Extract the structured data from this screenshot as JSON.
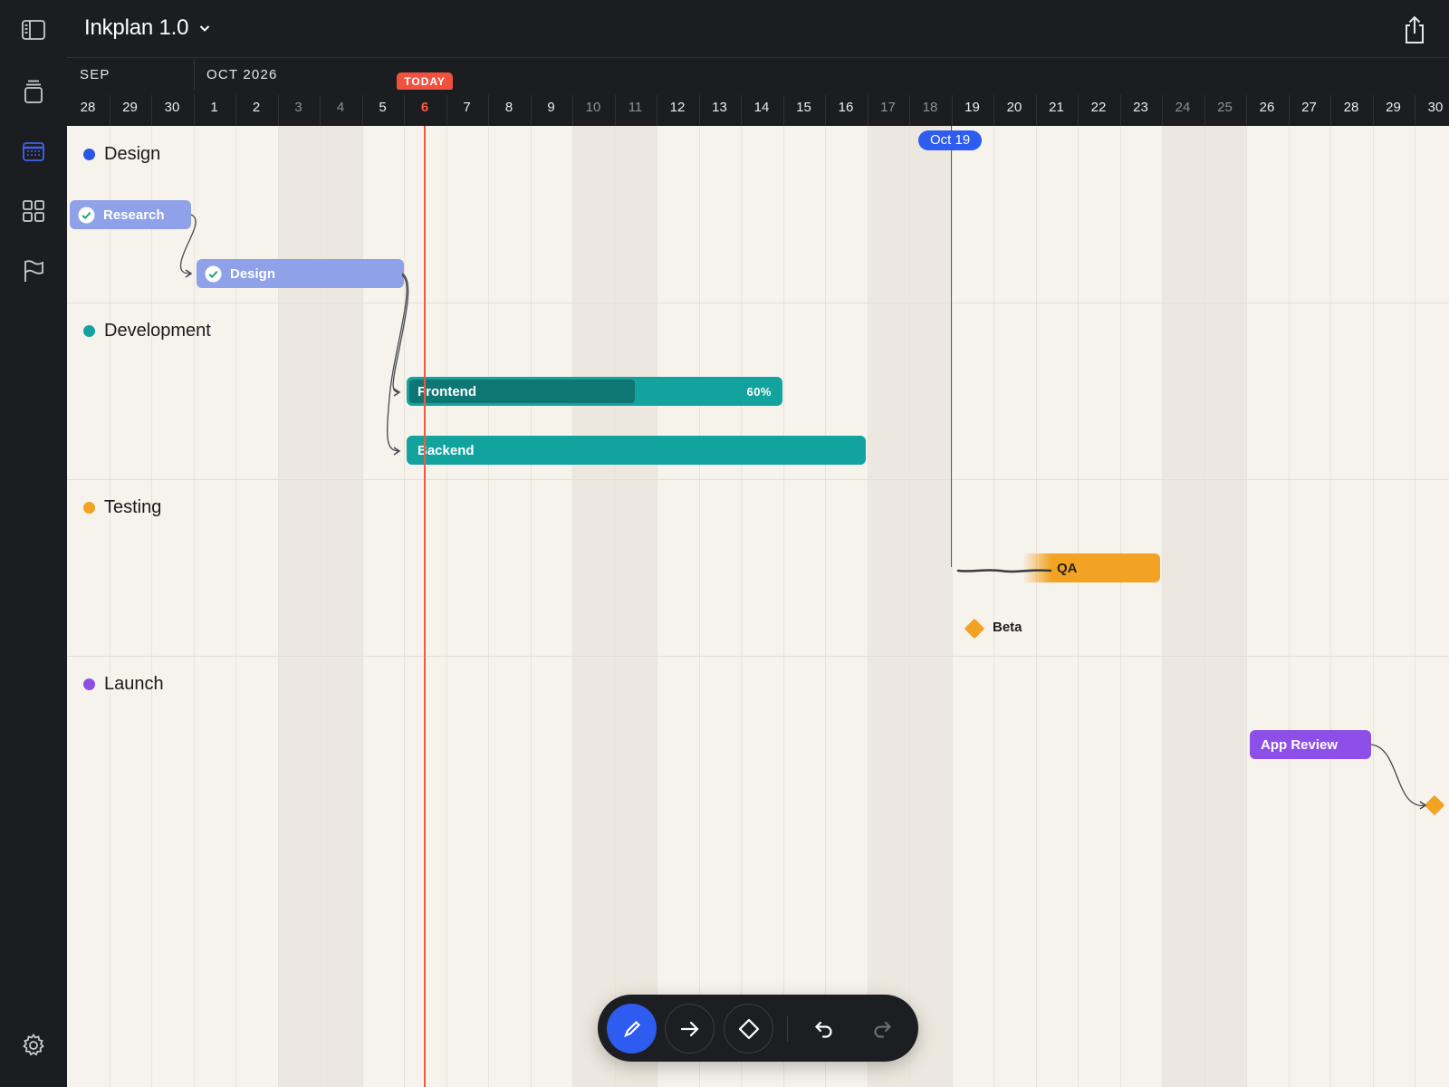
{
  "app": {
    "title": "Inkplan 1.0"
  },
  "sidebar": {
    "items": [
      {
        "name": "sidebar-toggle",
        "icon": "sidebar-icon"
      },
      {
        "name": "trash",
        "icon": "trash-icon"
      },
      {
        "name": "calendar",
        "icon": "calendar-icon",
        "active": true
      },
      {
        "name": "grid",
        "icon": "grid-icon"
      },
      {
        "name": "flag",
        "icon": "flag-icon"
      },
      {
        "name": "settings",
        "icon": "gear-icon"
      }
    ]
  },
  "timeline": {
    "months": [
      {
        "label": "SEP"
      },
      {
        "label": "OCT 2026"
      }
    ],
    "today_badge": "TODAY",
    "days": [
      "28",
      "29",
      "30",
      "1",
      "2",
      "3",
      "4",
      "5",
      "6",
      "7",
      "8",
      "9",
      "10",
      "11",
      "12",
      "13",
      "14",
      "15",
      "16",
      "17",
      "18",
      "19",
      "20",
      "21",
      "22",
      "23",
      "24",
      "25",
      "26",
      "27",
      "28",
      "29",
      "30"
    ],
    "weekend_days": [
      5,
      6,
      12,
      13,
      19,
      20,
      26,
      27
    ],
    "today_index": 8,
    "marker": {
      "label": "Oct 19",
      "day_index": 21
    }
  },
  "groups": [
    {
      "title": "Design",
      "color": "#2b55e6"
    },
    {
      "title": "Development",
      "color": "#12a39f"
    },
    {
      "title": "Testing",
      "color": "#f2a324"
    },
    {
      "title": "Launch",
      "color": "#8e4ee8"
    }
  ],
  "tasks": {
    "research": {
      "label": "Research",
      "done": true,
      "color": "#8fa1e8"
    },
    "design": {
      "label": "Design",
      "done": true,
      "color": "#8fa1e8"
    },
    "frontend": {
      "label": "Frontend",
      "progress_label": "60%",
      "progress": 0.6,
      "color": "#12a39f"
    },
    "backend": {
      "label": "Backend",
      "color": "#12a39f"
    },
    "qa": {
      "label": "QA",
      "color": "#f2a324"
    },
    "app_review": {
      "label": "App Review",
      "color": "#8e4ee8"
    }
  },
  "milestones": {
    "beta": {
      "label": "Beta",
      "color": "#f2a324"
    }
  },
  "toolbar": {
    "tools": [
      {
        "name": "pen",
        "icon": "pencil-icon",
        "active": true
      },
      {
        "name": "arrow",
        "icon": "arrow-right-icon"
      },
      {
        "name": "milestone",
        "icon": "diamond-icon"
      },
      {
        "name": "undo",
        "icon": "undo-icon"
      },
      {
        "name": "redo",
        "icon": "redo-icon",
        "disabled": true
      }
    ]
  }
}
